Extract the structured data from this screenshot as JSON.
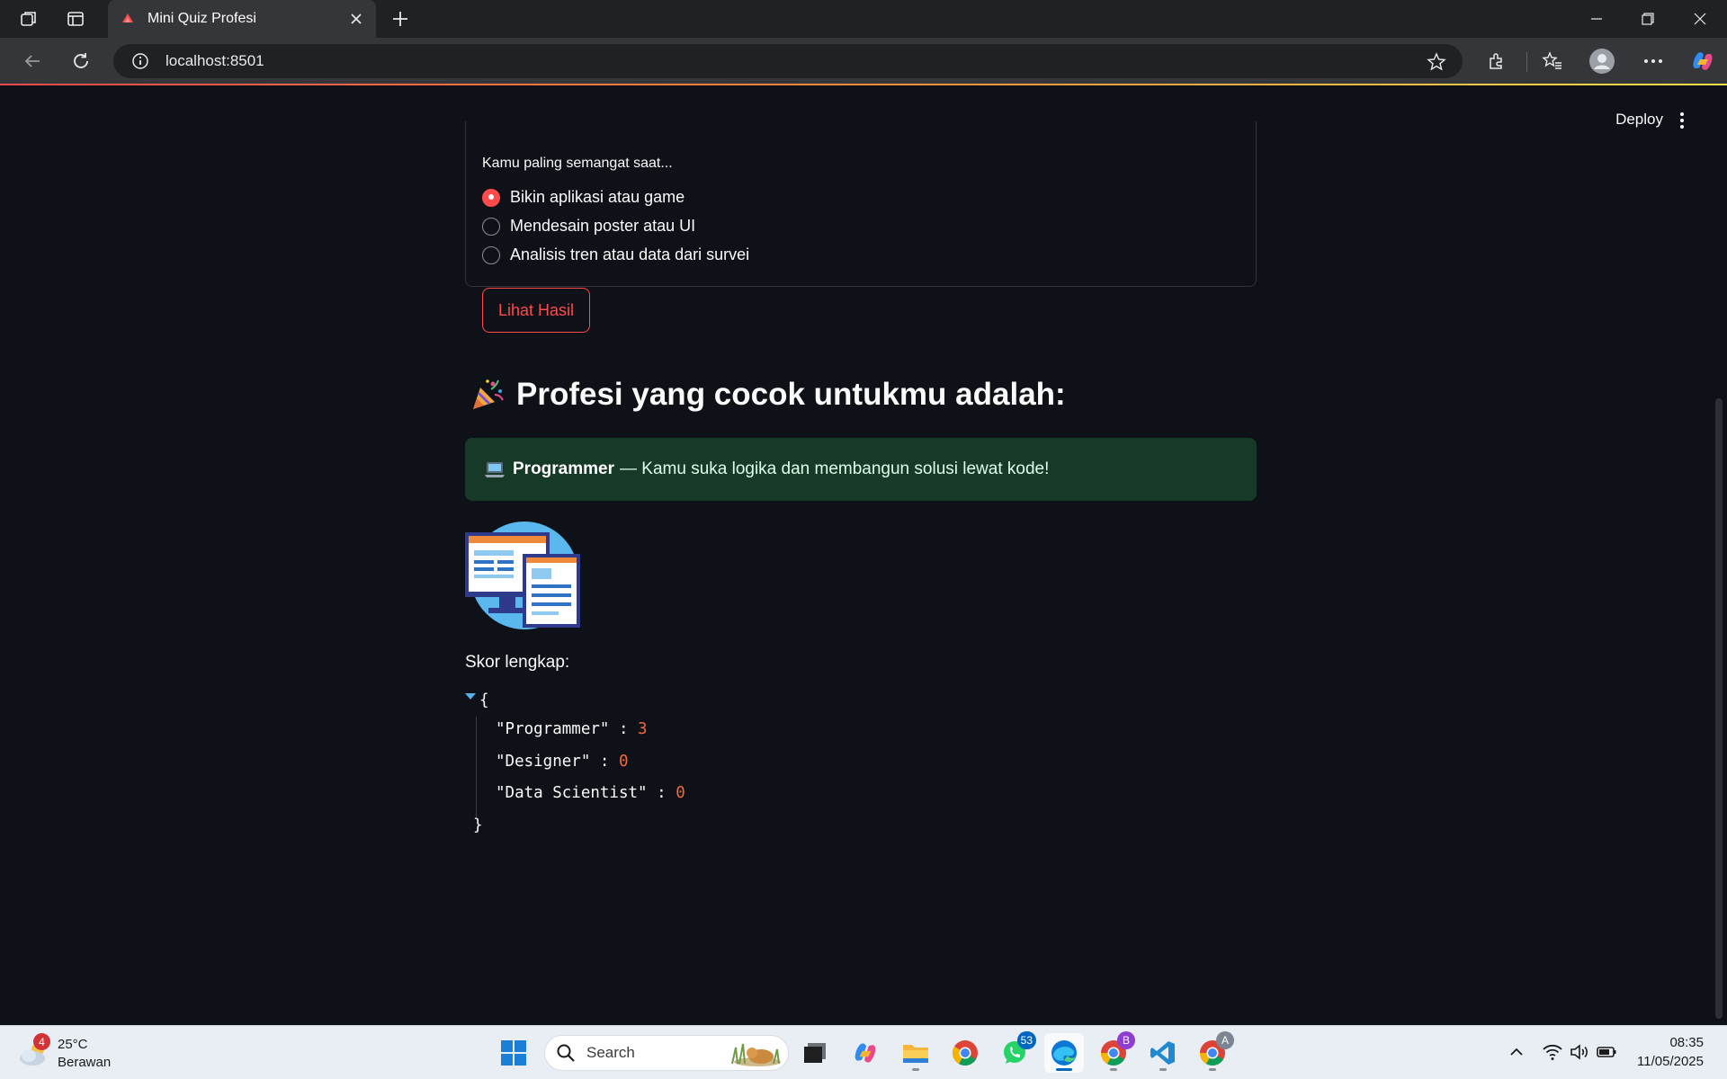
{
  "browser": {
    "tab_title": "Mini Quiz Profesi",
    "url": "localhost:8501"
  },
  "app": {
    "deploy_label": "Deploy",
    "quiz": {
      "question": "Kamu paling semangat saat...",
      "options": [
        {
          "label": "Bikin aplikasi atau game",
          "selected": true
        },
        {
          "label": "Mendesain poster atau UI",
          "selected": false
        },
        {
          "label": "Analisis tren atau data dari survei",
          "selected": false
        }
      ],
      "submit_label": "Lihat Hasil"
    },
    "result": {
      "heading": "Profesi yang cocok untukmu adalah:",
      "heading_icon": "party-popper-icon",
      "profession": "Programmer",
      "description": "— Kamu suka logika dan membangun solusi lewat kode!",
      "success_icon": "laptop-icon",
      "image_icon": "computer-illustration"
    },
    "scores": {
      "label": "Skor lengkap:",
      "open_brace": "{",
      "close_brace": "}",
      "entries": [
        {
          "key": "\"Programmer\"",
          "value": "3"
        },
        {
          "key": "\"Designer\"",
          "value": "0"
        },
        {
          "key": "\"Data Scientist\"",
          "value": "0"
        }
      ]
    },
    "colors": {
      "primary": "#ff4b4b",
      "background": "#0e1117",
      "success_bg": "#173928",
      "json_number": "#f06a3c"
    }
  },
  "taskbar": {
    "weather": {
      "temp": "25°C",
      "desc": "Berawan",
      "badge": "4"
    },
    "search_placeholder": "Search",
    "apps": [
      {
        "name": "windows-start-icon"
      },
      {
        "name": "search-box"
      },
      {
        "name": "task-view-icon"
      },
      {
        "name": "copilot-icon"
      },
      {
        "name": "file-explorer-icon"
      },
      {
        "name": "chrome-icon"
      },
      {
        "name": "whatsapp-icon",
        "badge": "53"
      },
      {
        "name": "edge-icon",
        "active": true
      },
      {
        "name": "chrome-profile-b-icon",
        "badge": "B"
      },
      {
        "name": "vscode-icon"
      },
      {
        "name": "chrome-profile-a-icon",
        "badge": "A"
      }
    ],
    "clock": {
      "time": "08:35",
      "date": "11/05/2025"
    }
  }
}
